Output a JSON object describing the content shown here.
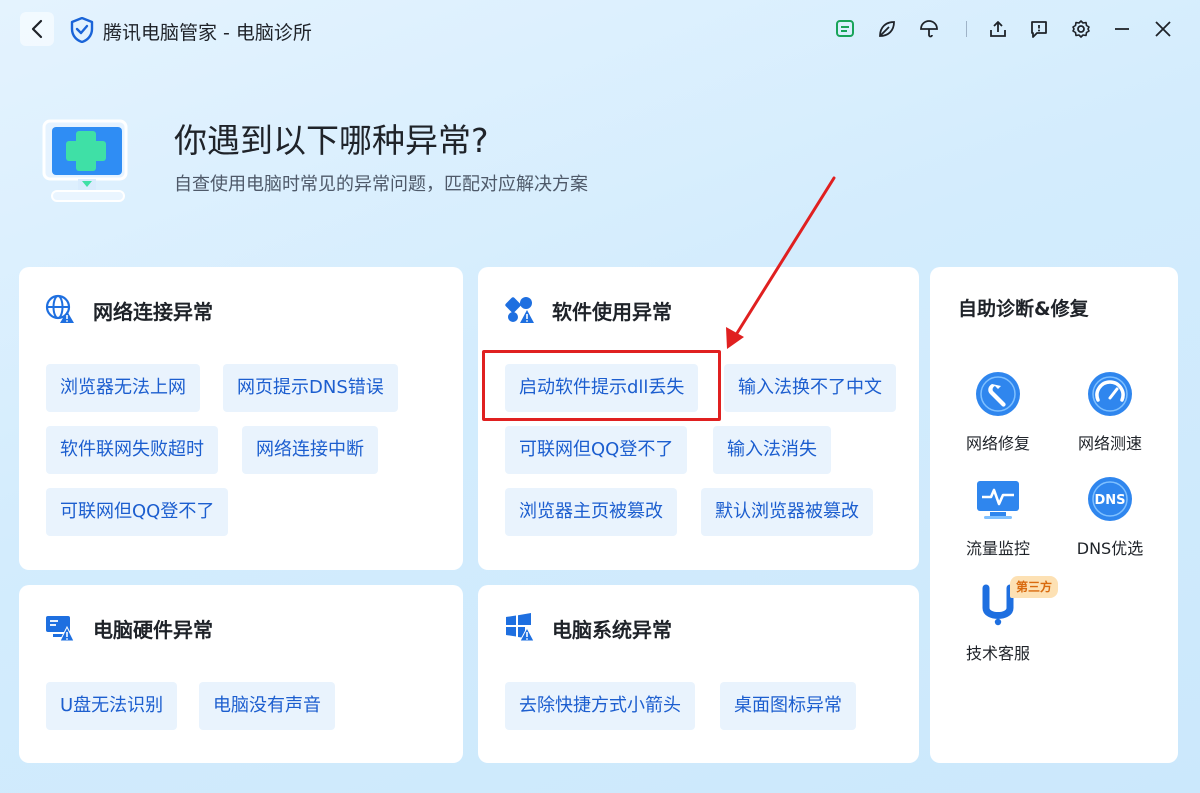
{
  "window": {
    "title": "腾讯电脑管家 - 电脑诊所"
  },
  "titlebar_icons": [
    "feedback-icon",
    "skin-leaf-icon",
    "umbrella-icon",
    "share-icon",
    "report-icon",
    "settings-gear-icon",
    "minimize-icon",
    "close-icon"
  ],
  "hero": {
    "title": "你遇到以下哪种异常?",
    "subtitle": "自查使用电脑时常见的异常问题，匹配对应解决方案"
  },
  "sections": {
    "network": {
      "title": "网络连接异常",
      "items": [
        "浏览器无法上网",
        "网页提示DNS错误",
        "软件联网失败超时",
        "网络连接中断",
        "可联网但QQ登不了"
      ]
    },
    "software": {
      "title": "软件使用异常",
      "items": [
        "启动软件提示dll丢失",
        "输入法换不了中文",
        "可联网但QQ登不了",
        "输入法消失",
        "浏览器主页被篡改",
        "默认浏览器被篡改"
      ]
    },
    "hardware": {
      "title": "电脑硬件异常",
      "items": [
        "U盘无法识别",
        "电脑没有声音"
      ]
    },
    "system": {
      "title": "电脑系统异常",
      "items": [
        "去除快捷方式小箭头",
        "桌面图标异常"
      ]
    }
  },
  "self_help": {
    "title": "自助诊断&修复",
    "tools": [
      "网络修复",
      "网络测速",
      "流量监控",
      "DNS优选",
      "技术客服"
    ],
    "badge": "第三方",
    "dns_icon_text": "DNS"
  },
  "colors": {
    "accent": "#1c5ecf",
    "chip_bg": "#e9f3fd",
    "annotation": "#e02020"
  }
}
